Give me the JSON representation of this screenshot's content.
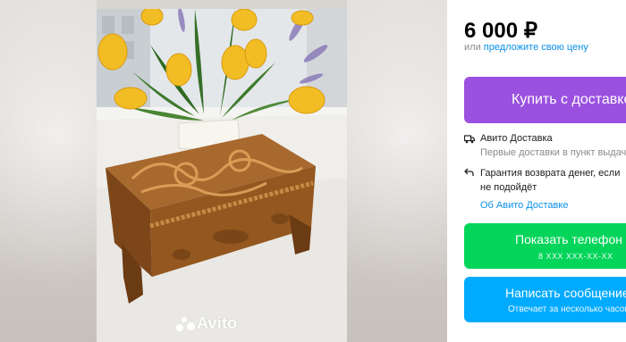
{
  "listing": {
    "price": "6 000 ₽",
    "offer_prefix": "или ",
    "offer_link": "предложите свою цену"
  },
  "buttons": {
    "buy_label": "Купить с доставкой",
    "phone_label": "Показать телефон",
    "phone_masked": "8 XXX XXX-XX-XX",
    "message_label": "Написать сообщение",
    "message_sub": "Отвечает за несколько часов"
  },
  "delivery": {
    "title": "Авито Доставка",
    "subtitle": "Первые доставки в пункт выдачи"
  },
  "guarantee": {
    "line1": "Гарантия возврата денег, если",
    "line2": "не подойдёт"
  },
  "about_link": "Об Авито Доставке",
  "gallery": {
    "watermark": "Avito"
  },
  "colors": {
    "buy": "#9b51e0",
    "phone": "#03d45a",
    "message": "#00aaff",
    "link": "#0a8fe8"
  },
  "icons": [
    "truck-icon",
    "return-arrow-icon",
    "avito-dots-icon"
  ]
}
